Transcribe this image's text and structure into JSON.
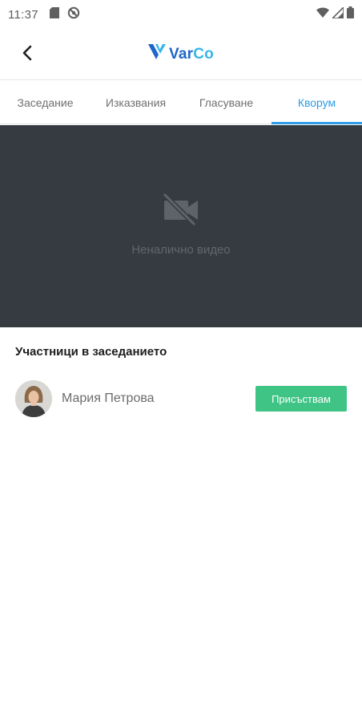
{
  "status_bar": {
    "time": "11:37",
    "icons_left": [
      "sd-card-icon",
      "no-disturb-icon"
    ],
    "icons_right": [
      "wifi-icon",
      "signal-icon",
      "battery-icon"
    ]
  },
  "header": {
    "logo_text_prefix": "Var",
    "logo_text_suffix": "Co",
    "logo_colors": {
      "primary": "#1f66c8",
      "accent": "#36b7e8"
    }
  },
  "tabs": [
    {
      "label": "Заседание",
      "active": false
    },
    {
      "label": "Изказвания",
      "active": false
    },
    {
      "label": "Гласуване",
      "active": false
    },
    {
      "label": "Кворум",
      "active": true
    }
  ],
  "video": {
    "status_text": "Неналично видео"
  },
  "participants": {
    "title": "Участници в заседанието",
    "items": [
      {
        "name": "Мария Петрова",
        "action_label": "Присъствам"
      }
    ]
  },
  "colors": {
    "accent": "#2d9be6",
    "video_bg": "#363b42",
    "present_button": "#3fc486"
  }
}
